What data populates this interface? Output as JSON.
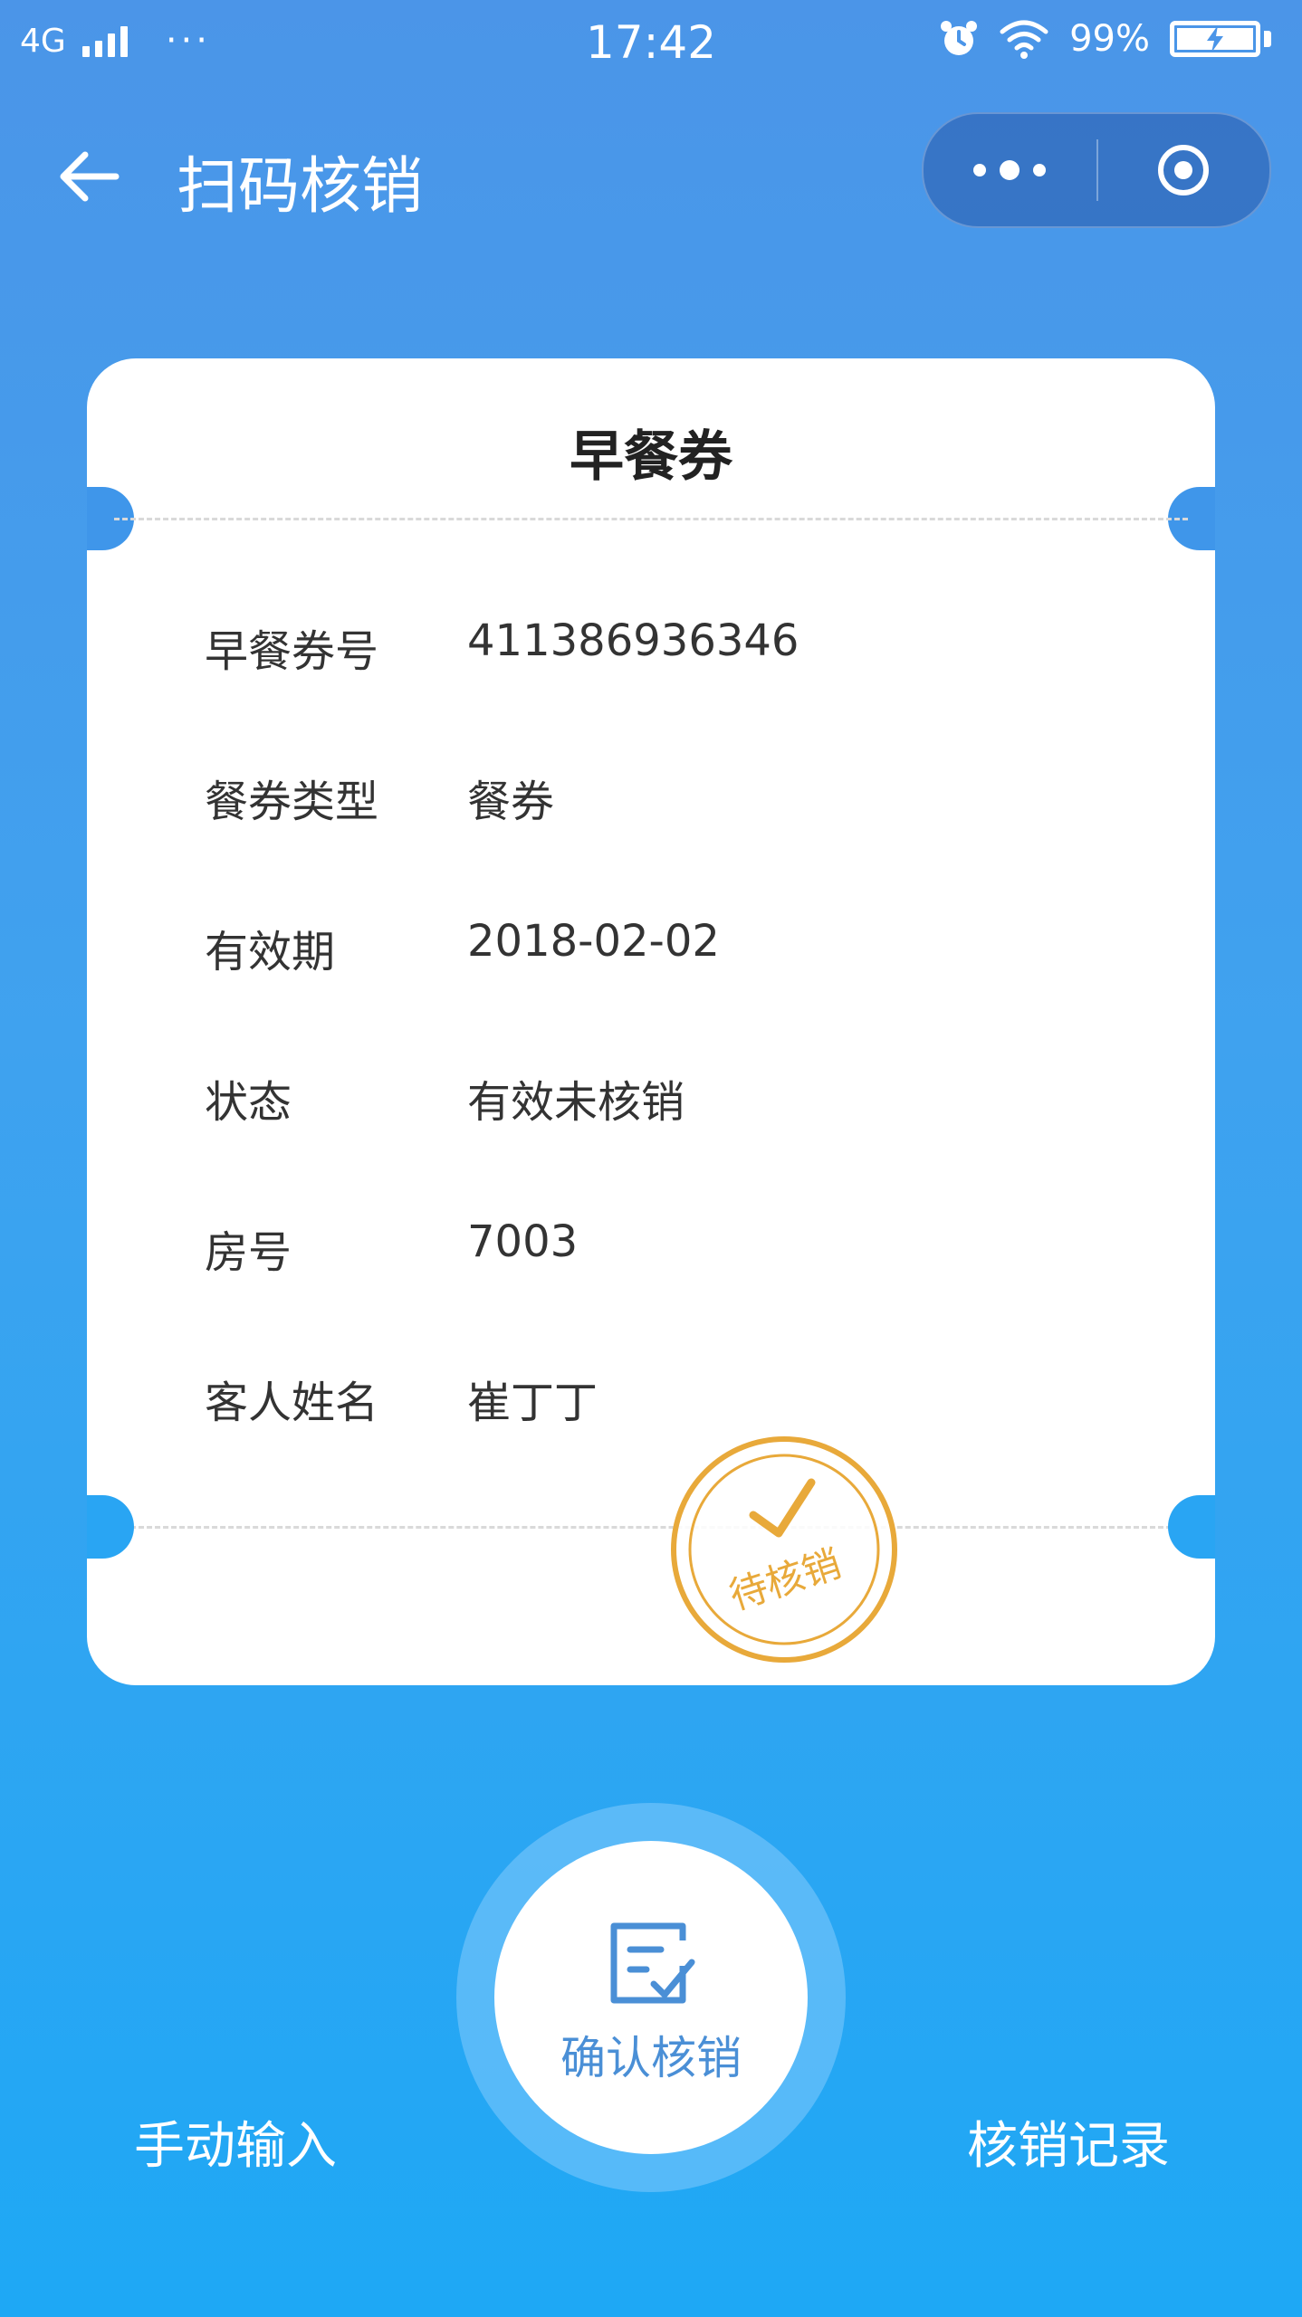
{
  "status_bar": {
    "network": "4G",
    "dots": "···",
    "time": "17:42",
    "battery": "99%"
  },
  "header": {
    "title": "扫码核销"
  },
  "ticket": {
    "title": "早餐券",
    "fields": [
      {
        "label": "早餐券号",
        "value": "411386936346"
      },
      {
        "label": "餐券类型",
        "value": "餐券"
      },
      {
        "label": "有效期",
        "value": "2018-02-02"
      },
      {
        "label": "状态",
        "value": "有效未核销"
      },
      {
        "label": "房号",
        "value": "7003"
      },
      {
        "label": "客人姓名",
        "value": "崔丁丁"
      }
    ],
    "stamp_text": "待核销",
    "stamp_color": "#e8a93a"
  },
  "actions": {
    "confirm_label": "确认核销",
    "manual_label": "手动输入",
    "records_label": "核销记录"
  },
  "colors": {
    "accent": "#4a8fd6",
    "background_top": "#4b95e8",
    "background_bottom": "#1ea8f5"
  },
  "icons": [
    "back-arrow-icon",
    "more-dots-icon",
    "close-circle-icon",
    "alarm-icon",
    "wifi-icon",
    "battery-icon",
    "checklist-icon",
    "stamp-check-icon"
  ]
}
